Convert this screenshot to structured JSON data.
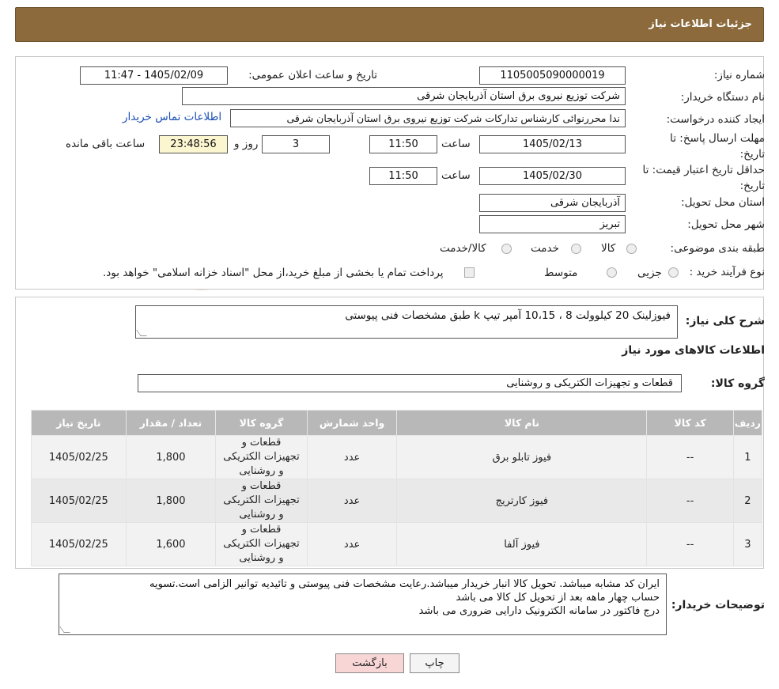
{
  "header": {
    "title": "جزئیات اطلاعات نیاز"
  },
  "watermark": {
    "text": "AriaTender.neT"
  },
  "fields": {
    "need_number_label": "شماره نیاز:",
    "need_number": "1105005090000019",
    "announce_label": "تاریخ و ساعت اعلان عمومی:",
    "announce_value": "1405/02/09 - 11:47",
    "buyer_org_label": "نام دستگاه خریدار:",
    "buyer_org": "شرکت توزیع نیروی برق استان آذربایجان شرقی",
    "creator_label": "ایجاد کننده درخواست:",
    "creator": "ندا محررنوائی کارشناس تداركات شركت توزیع نیروی برق استان آذربایجان شرقی",
    "contact_link": "اطلاعات تماس خریدار",
    "reply_deadline_label": "مهلت ارسال پاسخ: تا تاریخ:",
    "reply_date": "1405/02/13",
    "time_label": "ساعت",
    "reply_time": "11:50",
    "days_value": "3",
    "days_label": "روز و",
    "remaining_time": "23:48:56",
    "remaining_label": "ساعت باقی مانده",
    "price_validity_label": "حداقل تاریخ اعتبار قیمت: تا تاریخ:",
    "price_date": "1405/02/30",
    "price_time": "11:50",
    "province_label": "استان محل تحویل:",
    "province": "آذربایجان شرقی",
    "city_label": "شهر محل تحویل:",
    "city": "تبریز",
    "category_label": "طبقه بندی موضوعی:",
    "category_options": [
      "کالا",
      "خدمت",
      "کالا/خدمت"
    ],
    "process_label": "نوع فرآیند خرید :",
    "process_options": [
      "جزیی",
      "متوسط"
    ],
    "process_note": "پرداخت تمام یا بخشی از مبلغ خرید،از محل \"اسناد خزانه اسلامی\" خواهد بود."
  },
  "description": {
    "label": "شرح کلی نیاز:",
    "text": "فیوزلینک 20 کیلوولت 8 ، 10،15 آمپر تیپ k طبق مشخصات فنی پیوستی"
  },
  "goods_info": {
    "section_title": "اطلاعات کالاهای مورد نیاز",
    "group_label": "گروه کالا:",
    "group_value": "قطعات و تجهیزات الکتریکی و روشنایی"
  },
  "table": {
    "headers": [
      "ردیف",
      "کد کالا",
      "نام کالا",
      "واحد شمارش",
      "گروه کالا",
      "تعداد / مقدار",
      "تاریخ نیاز"
    ],
    "rows": [
      {
        "row": "1",
        "code": "--",
        "name": "فیوز تابلو برق",
        "unit": "عدد",
        "group": "قطعات و تجهیزات الکتریکی و روشنایی",
        "qty": "1,800",
        "date": "1405/02/25"
      },
      {
        "row": "2",
        "code": "--",
        "name": "فیوز کارتریج",
        "unit": "عدد",
        "group": "قطعات و تجهیزات الکتریکی و روشنایی",
        "qty": "1,800",
        "date": "1405/02/25"
      },
      {
        "row": "3",
        "code": "--",
        "name": "فیوز آلفا",
        "unit": "عدد",
        "group": "قطعات و تجهیزات الکتریکی و روشنایی",
        "qty": "1,600",
        "date": "1405/02/25"
      }
    ]
  },
  "buyer_notes": {
    "label": "توضیحات خریدار:",
    "line1": "ایران کد مشابه میباشد. تحویل کالا انبار خریدار میباشد.رعایت مشخصات فنی پیوستی و تائیدیه توانیر الزامی است.تسویه",
    "line2": "حساب چهار ماهه بعد از تحویل کل کالا می باشد",
    "line3": "درج فاکتور در سامانه الکترونیک دارایی ضروری می باشد"
  },
  "buttons": {
    "print": "چاپ",
    "back": "بازگشت"
  }
}
